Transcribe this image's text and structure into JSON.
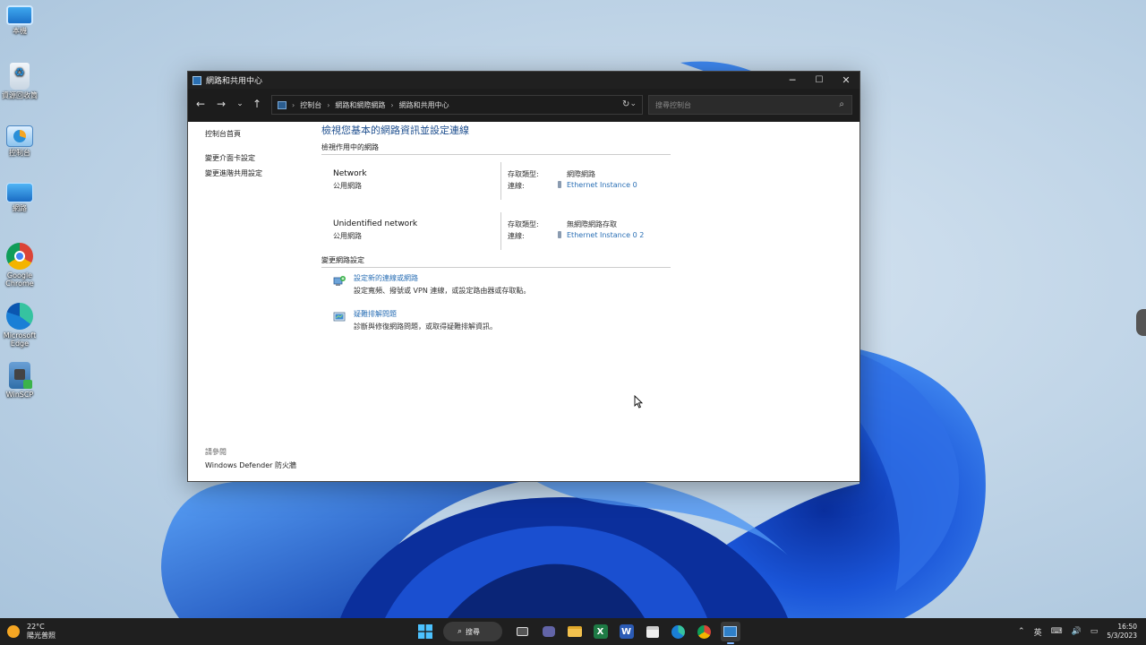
{
  "desktop": {
    "icons": [
      {
        "label": "本機",
        "icon": "this-pc-icon"
      },
      {
        "label": "資源回收筒",
        "icon": "recycle-bin-icon"
      },
      {
        "label": "控制台",
        "icon": "control-panel-icon"
      },
      {
        "label": "網路",
        "icon": "network-icon"
      },
      {
        "label": "Google Chrome",
        "icon": "chrome-icon"
      },
      {
        "label": "Microsoft Edge",
        "icon": "edge-icon"
      },
      {
        "label": "WinSCP",
        "icon": "winscp-icon"
      }
    ]
  },
  "window": {
    "title": "網路和共用中心",
    "breadcrumb": [
      "控制台",
      "網路和網際網路",
      "網路和共用中心"
    ],
    "search_placeholder": "搜尋控制台",
    "controls": {
      "minimize": "─",
      "maximize": "☐",
      "close": "✕"
    }
  },
  "left_pane": {
    "home": "控制台首頁",
    "links": [
      "變更介面卡設定",
      "變更進階共用設定"
    ],
    "see_also_label": "請參閱",
    "see_also_links": [
      "Windows Defender 防火牆"
    ]
  },
  "main": {
    "heading": "檢視您基本的網路資訊並設定連線",
    "active_networks_label": "檢視作用中的網路",
    "networks": [
      {
        "name": "Network",
        "type": "公用網路",
        "access_label": "存取類型:",
        "access_value": "網際網路",
        "connection_label": "連線:",
        "connection_value": "Ethernet Instance 0"
      },
      {
        "name": "Unidentified network",
        "type": "公用網路",
        "access_label": "存取類型:",
        "access_value": "無網際網路存取",
        "connection_label": "連線:",
        "connection_value": "Ethernet Instance 0 2"
      }
    ],
    "change_settings_label": "變更網路設定",
    "tasks": [
      {
        "link": "設定新的連線或網路",
        "desc": "設定寬頻、撥號或 VPN 連線，或設定路由器或存取點。",
        "icon": "new-connection-icon"
      },
      {
        "link": "疑難排解問題",
        "desc": "診斷與修復網路問題，或取得疑難排解資訊。",
        "icon": "troubleshoot-icon"
      }
    ]
  },
  "taskbar": {
    "weather_temp": "22°C",
    "weather_desc": "陽光普照",
    "search_label": "搜尋",
    "ime": "英",
    "time": "16:50",
    "date": "5/3/2023",
    "apps": [
      "start-icon",
      "task-view-icon",
      "teams-icon",
      "file-explorer-icon",
      "excel-icon",
      "word-icon",
      "store-icon",
      "edge-icon",
      "chrome-icon",
      "control-panel-icon"
    ]
  }
}
